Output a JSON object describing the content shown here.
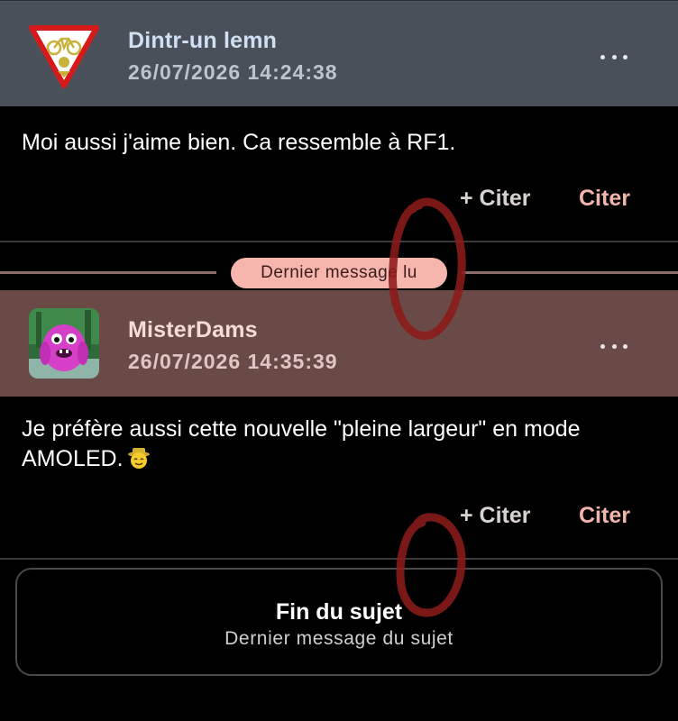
{
  "posts": [
    {
      "author": "Dintr-un lemn",
      "timestamp": "26/07/2026 14:24:38",
      "avatar": "yield-sign-bicycle-icon",
      "text": "Moi aussi j'aime bien. Ca ressemble à RF1.",
      "actions": {
        "quote_plus": "+ Citer",
        "quote": "Citer"
      }
    },
    {
      "author": "MisterDams",
      "timestamp": "26/07/2026 14:35:39",
      "avatar": "pink-monster-avatar",
      "text": "Je préfère aussi cette nouvelle \"pleine largeur\" en mode AMOLED.",
      "emoji": "smiling-face-with-hat-emoji",
      "actions": {
        "quote_plus": "+ Citer",
        "quote": "Citer"
      }
    }
  ],
  "unread_divider": {
    "label": "Dernier message lu"
  },
  "end_of_topic": {
    "title": "Fin du sujet",
    "subtitle": "Dernier message du sujet"
  },
  "colors": {
    "header_1_bg": "#49505a",
    "header_2_bg": "#6a4a47",
    "accent": "#f1b5ab",
    "badge_bg": "#f6b6ad",
    "annotation": "#8b1a1a",
    "background": "#000000"
  }
}
